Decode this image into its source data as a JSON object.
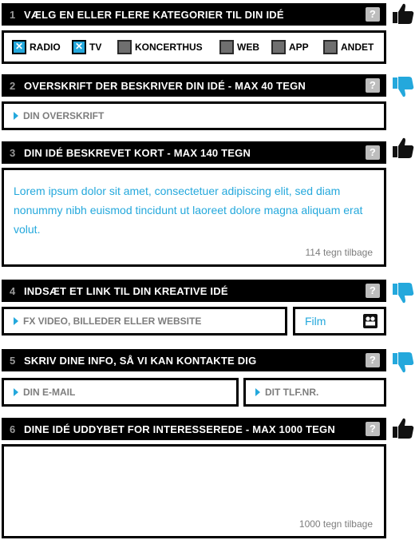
{
  "sections": [
    {
      "num": "1",
      "title": "VÆLG EN ELLER FLERE KATEGORIER TIL DIN IDÉ",
      "help": "?"
    },
    {
      "num": "2",
      "title": "OVERSKRIFT DER BESKRIVER DIN IDÉ - MAX 40 TEGN",
      "help": "?"
    },
    {
      "num": "3",
      "title": "DIN IDÉ BESKREVET KORT - MAX 140 TEGN",
      "help": "?"
    },
    {
      "num": "4",
      "title": "INDSÆT ET LINK TIL DIN KREATIVE IDÉ",
      "help": "?"
    },
    {
      "num": "5",
      "title": "SKRIV DINE INFO, SÅ VI KAN KONTAKTE DIG",
      "help": "?"
    },
    {
      "num": "6",
      "title": "DINE IDÉ UDDYBET FOR INTERESSEREDE - MAX 1000 TEGN",
      "help": "?"
    }
  ],
  "categories": [
    {
      "label": "RADIO",
      "checked": true
    },
    {
      "label": "TV",
      "checked": true
    },
    {
      "label": "KONCERTHUS",
      "checked": false
    },
    {
      "label": "WEB",
      "checked": false
    },
    {
      "label": "APP",
      "checked": false
    },
    {
      "label": "ANDET",
      "checked": false
    }
  ],
  "headline": {
    "placeholder": "DIN OVERSKRIFT"
  },
  "short_desc": {
    "text": "Lorem ipsum dolor sit amet, consectetuer adipiscing elit, sed diam nonummy nibh euismod tincidunt ut laoreet dolore magna aliquam erat volut.",
    "counter": "114 tegn tilbage"
  },
  "link": {
    "placeholder": "FX VIDEO, BILLEDER ELLER WEBSITE",
    "type_label": "Film",
    "type_icon": "camera-icon"
  },
  "contact": {
    "email_placeholder": "DIN E-MAIL",
    "phone_placeholder": "DIT TLF.NR."
  },
  "long_desc": {
    "counter": "1000 tegn tilbage"
  },
  "thumbs": [
    "thumbs-up",
    "thumbs-down",
    "thumbs-up",
    "thumbs-down",
    "thumbs-down",
    "thumbs-up"
  ],
  "colors": {
    "accent": "#24a8dc",
    "header": "#000000",
    "muted": "#7d7d7d"
  }
}
